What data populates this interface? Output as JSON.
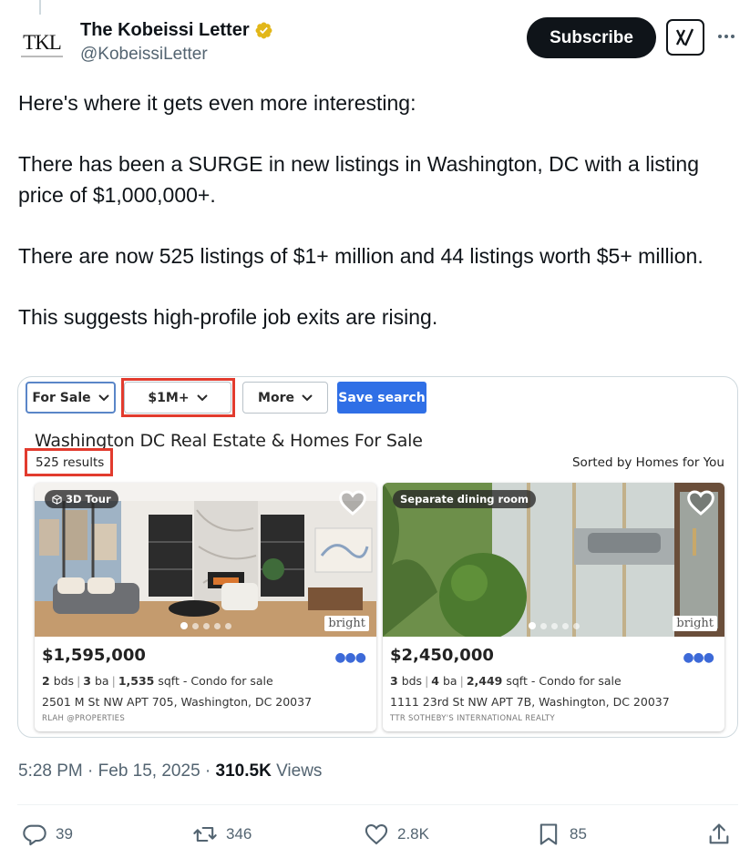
{
  "author": {
    "display_name": "The Kobeissi Letter",
    "handle": "@KobeissiLetter",
    "avatar_text": "TKL",
    "verified_color": "#e2b719"
  },
  "header": {
    "subscribe_label": "Subscribe",
    "grok_icon": "grok-icon",
    "more_icon": "more-icon"
  },
  "tweet": {
    "paragraphs": [
      "Here's where it gets even more interesting:",
      "There has been a SURGE in new listings in Washington, DC with a listing price of $1,000,000+.",
      "There are now 525 listings of $1+ million and 44 listings worth $5+ million.",
      "This suggests high-profile job exits are rising."
    ]
  },
  "media": {
    "filters": {
      "for_sale": "For Sale",
      "price": "$1M+",
      "more": "More",
      "save_search": "Save search"
    },
    "title": "Washington DC Real Estate & Homes For Sale",
    "results": "525 results",
    "sorted": "Sorted by Homes for You",
    "listings": [
      {
        "tag": "3D Tour",
        "price": "$1,595,000",
        "beds": "2",
        "beds_unit": "bds",
        "baths": "3",
        "baths_unit": "ba",
        "sqft": "1,535",
        "sqft_unit": "sqft",
        "type": "- Condo for sale",
        "address": "2501 M St NW APT 705, Washington, DC 20037",
        "broker": "RLAH @PROPERTIES",
        "badge": "bright"
      },
      {
        "tag": "Separate dining room",
        "price": "$2,450,000",
        "beds": "3",
        "beds_unit": "bds",
        "baths": "4",
        "baths_unit": "ba",
        "sqft": "2,449",
        "sqft_unit": "sqft",
        "type": "- Condo for sale",
        "address": "1111 23rd St NW APT 7B, Washington, DC 20037",
        "broker": "TTR SOTHEBY'S INTERNATIONAL REALTY",
        "badge": "bright"
      }
    ],
    "highlight_color": "#e23b2e",
    "accent_color": "#2f6fe6"
  },
  "meta": {
    "time": "5:28 PM",
    "dot1": "·",
    "date": "Feb 15, 2025",
    "dot2": "·",
    "views_count": "310.5K",
    "views_label": "Views"
  },
  "actions": {
    "replies": "39",
    "reposts": "346",
    "likes": "2.8K",
    "bookmarks": "85"
  }
}
